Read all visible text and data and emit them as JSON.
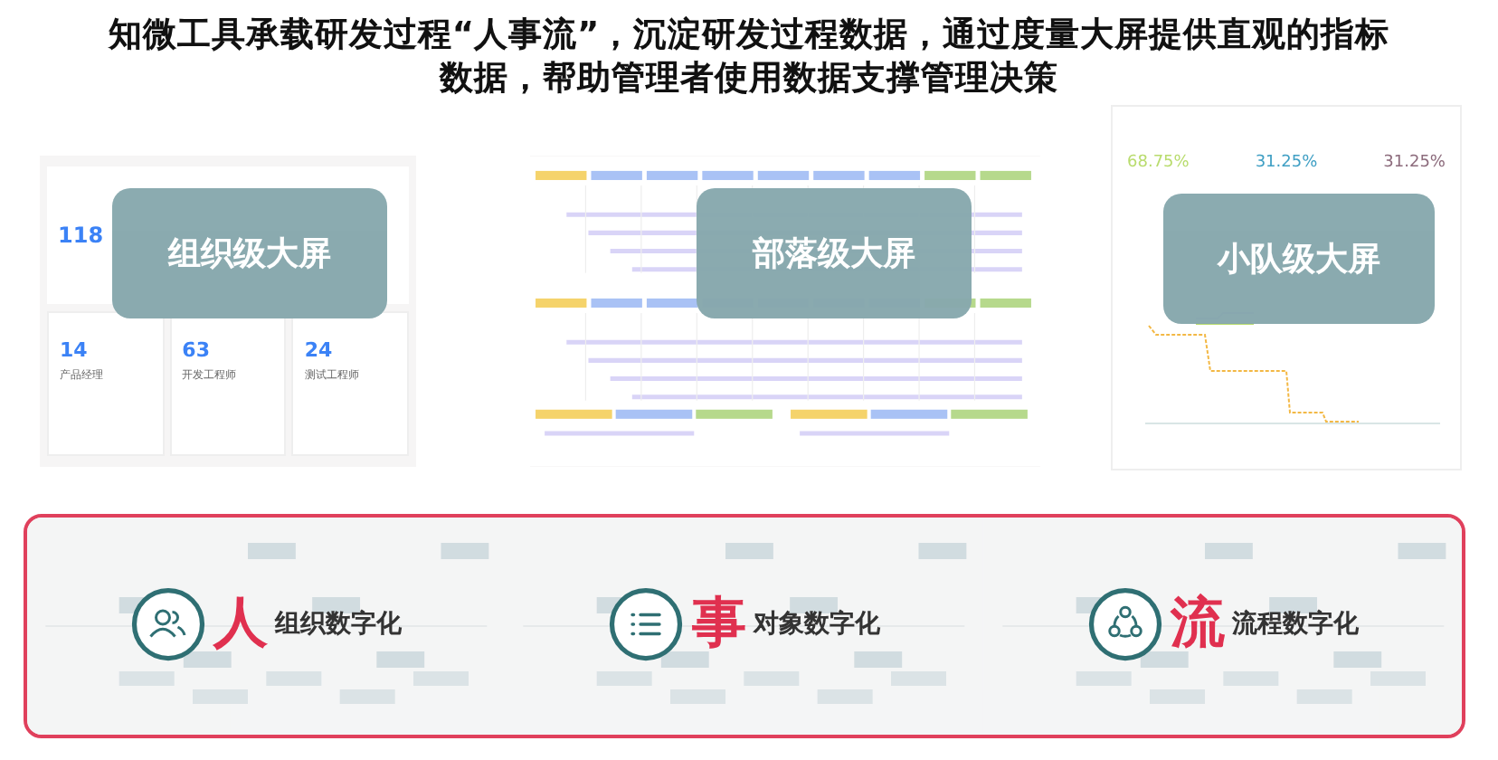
{
  "title_lines": [
    "知微工具承载研发过程“人事流”，沉淀研发过程数据，通过度量大屏提供直观的指标",
    "数据，帮助管理者使用数据支撑管理决策"
  ],
  "org_screen": {
    "total": "118",
    "cards": [
      {
        "value": "14",
        "label": "产品经理"
      },
      {
        "value": "63",
        "label": "开发工程师"
      },
      {
        "value": "24",
        "label": "测试工程师"
      }
    ],
    "overlay": "组织级大屏"
  },
  "tribe_screen": {
    "overlay": "部落级大屏"
  },
  "team_screen": {
    "stats": [
      {
        "value": "68.75%",
        "color": "#b9dc6e"
      },
      {
        "value": "31.25%",
        "color": "#3f9fc4"
      },
      {
        "value": "31.25%",
        "color": "#8c6b7c"
      }
    ],
    "overlay": "小队级大屏"
  },
  "digitization": [
    {
      "kind": "people",
      "char": "人",
      "label": "组织数字化"
    },
    {
      "kind": "list",
      "char": "事",
      "label": "对象数字化"
    },
    {
      "kind": "cycle",
      "char": "流",
      "label": "流程数字化"
    }
  ]
}
